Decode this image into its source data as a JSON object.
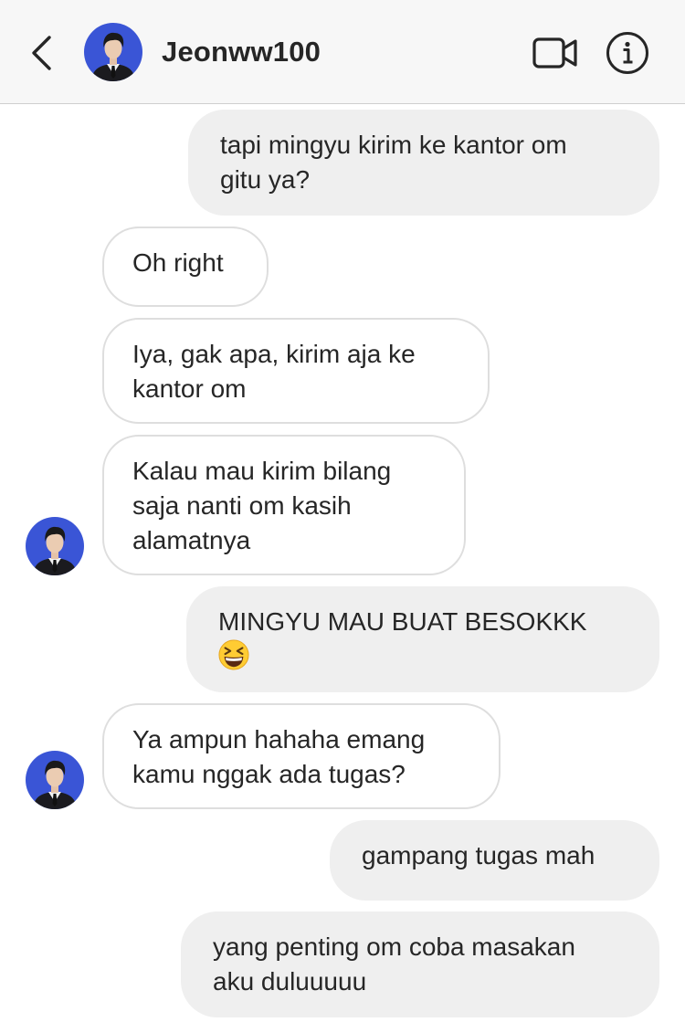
{
  "header": {
    "contact_name": "Jeonww100",
    "back_icon": "chevron-left-icon",
    "video_icon": "video-call-icon",
    "info_icon": "info-icon"
  },
  "messages": [
    {
      "side": "outgoing",
      "lines": [
        "tapi mingyu kirim ke kantor om",
        "gitu ya?"
      ]
    },
    {
      "side": "incoming",
      "lines": [
        "Oh right"
      ]
    },
    {
      "side": "incoming",
      "lines": [
        "Iya, gak apa, kirim aja ke",
        "kantor om"
      ]
    },
    {
      "side": "incoming",
      "lines": [
        "Kalau mau kirim bilang",
        "saja nanti om kasih",
        "alamatnya"
      ],
      "avatar": true
    },
    {
      "side": "outgoing",
      "lines": [
        "MINGYU MAU BUAT BESOKKK"
      ],
      "emoji": "grinning-squinting-face-emoji"
    },
    {
      "side": "incoming",
      "lines": [
        "Ya ampun hahaha emang",
        "kamu nggak ada tugas?"
      ],
      "avatar": true
    },
    {
      "side": "outgoing",
      "lines": [
        "gampang tugas mah"
      ]
    },
    {
      "side": "outgoing",
      "lines": [
        "yang penting om coba masakan",
        "aku duluuuuu"
      ]
    }
  ],
  "colors": {
    "header_bg": "#f7f7f7",
    "outgoing_bubble": "#efefef",
    "incoming_border": "#dedede",
    "avatar_bg": "#3a55d6",
    "text": "#262626"
  }
}
